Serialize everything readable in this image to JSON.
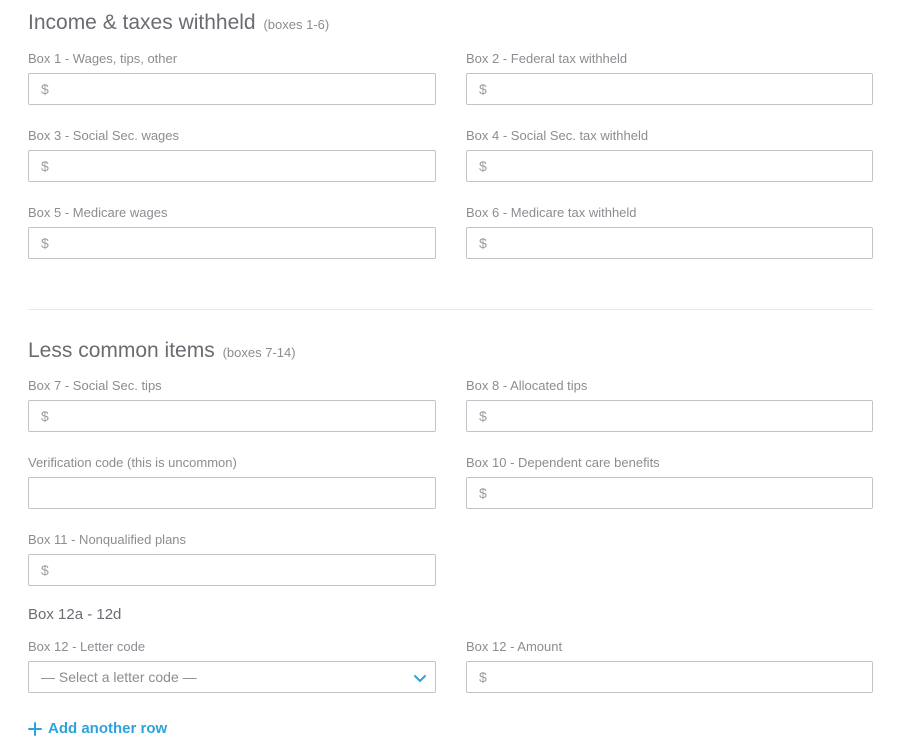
{
  "section_income": {
    "title": "Income & taxes withheld",
    "subtitle": "(boxes 1-6)"
  },
  "section_less_common": {
    "title": "Less common items",
    "subtitle": "(boxes 7-14)"
  },
  "currency_symbol": "$",
  "fields": {
    "box1": {
      "label": "Box 1 - Wages, tips, other",
      "value": ""
    },
    "box2": {
      "label": "Box 2 - Federal tax withheld",
      "value": ""
    },
    "box3": {
      "label": "Box 3 - Social Sec. wages",
      "value": ""
    },
    "box4": {
      "label": "Box 4 - Social Sec. tax withheld",
      "value": ""
    },
    "box5": {
      "label": "Box 5 - Medicare wages",
      "value": ""
    },
    "box6": {
      "label": "Box 6 - Medicare tax withheld",
      "value": ""
    },
    "box7": {
      "label": "Box 7 - Social Sec. tips",
      "value": ""
    },
    "box8": {
      "label": "Box 8 - Allocated tips",
      "value": ""
    },
    "verification": {
      "label": "Verification code (this is uncommon)",
      "value": ""
    },
    "box10": {
      "label": "Box 10 - Dependent care benefits",
      "value": ""
    },
    "box11": {
      "label": "Box 11 - Nonqualified plans",
      "value": ""
    }
  },
  "box12": {
    "heading": "Box 12a - 12d",
    "letter_code_label": "Box 12 - Letter code",
    "letter_code_placeholder": "— Select a letter code —",
    "amount_label": "Box 12 - Amount",
    "amount_value": ""
  },
  "add_row_label": "Add another row",
  "accent_color": "#2ca3dc"
}
